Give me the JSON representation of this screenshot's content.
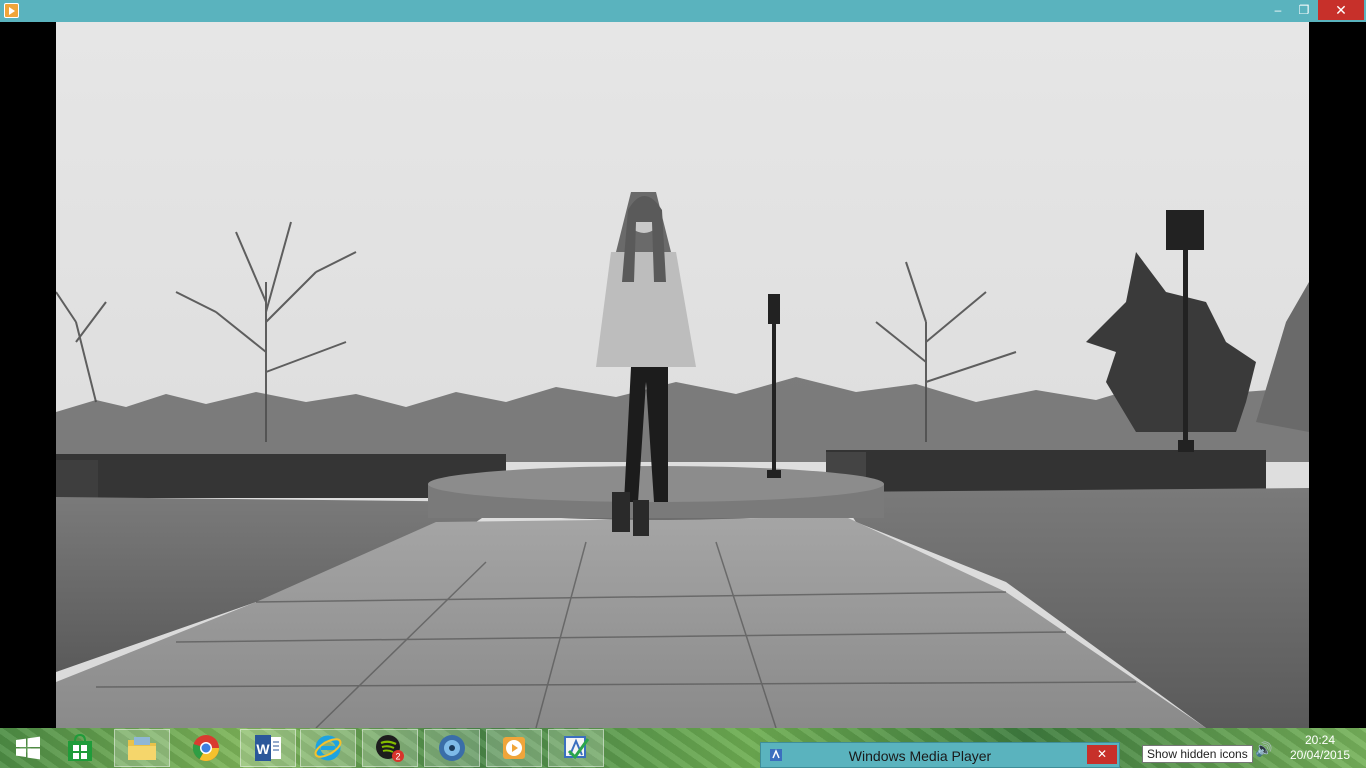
{
  "window": {
    "title_icon": "media-player-icon",
    "controls": {
      "minimize": "–",
      "maximize": "❐",
      "close": "✕"
    }
  },
  "taskbar": {
    "items": [
      {
        "name": "start-button",
        "icon": "windows-logo-icon"
      },
      {
        "name": "store",
        "icon": "store-icon"
      },
      {
        "name": "file-explorer",
        "icon": "folder-icon"
      },
      {
        "name": "chrome",
        "icon": "chrome-icon"
      },
      {
        "name": "word",
        "icon": "word-icon"
      },
      {
        "name": "internet-explorer",
        "icon": "ie-icon"
      },
      {
        "name": "spotify",
        "icon": "spotify-icon",
        "badge": "2"
      },
      {
        "name": "disc-app",
        "icon": "disc-icon"
      },
      {
        "name": "media-player",
        "icon": "media-player-icon"
      },
      {
        "name": "paint",
        "icon": "paint-icon"
      }
    ],
    "thumbnail": {
      "label": "Windows Media Player",
      "close": "✕"
    },
    "tooltip": "Show hidden icons",
    "volume_icon": "🔊",
    "clock": {
      "time": "20:24",
      "date": "20/04/2015"
    }
  },
  "colors": {
    "titlebar": "#5ab3be",
    "close": "#c7302a"
  }
}
